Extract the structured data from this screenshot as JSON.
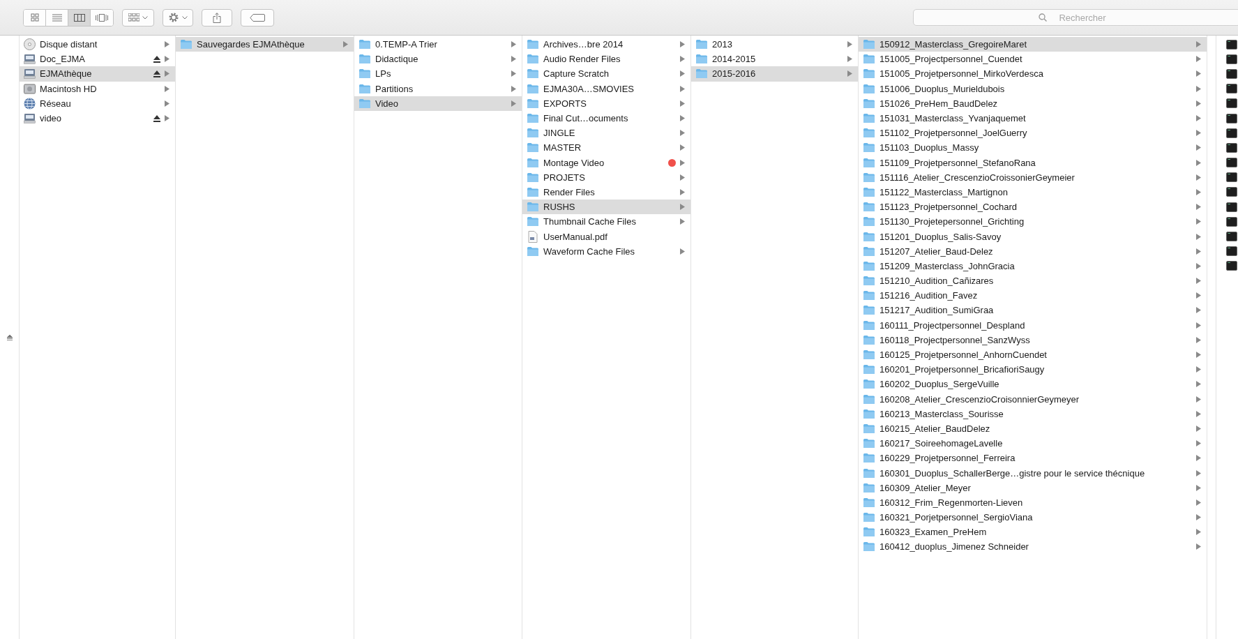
{
  "toolbar": {
    "views": [
      {
        "kind": "icons",
        "selected": false
      },
      {
        "kind": "list",
        "selected": false
      },
      {
        "kind": "columns",
        "selected": true
      },
      {
        "kind": "coverflow",
        "selected": false
      }
    ],
    "tools": [
      {
        "kind": "arrange"
      },
      {
        "kind": "action"
      },
      {
        "kind": "share"
      },
      {
        "kind": "tag"
      }
    ]
  },
  "search": {
    "placeholder": "Rechercher"
  },
  "columns": [
    {
      "items": [
        {
          "name": "Disque distant",
          "kind": "cd",
          "selected": false,
          "eject": false,
          "expandable": true
        },
        {
          "name": "Doc_EJMA",
          "kind": "drive",
          "selected": false,
          "eject": true,
          "expandable": true
        },
        {
          "name": "EJMAthèque",
          "kind": "drive",
          "selected": true,
          "eject": true,
          "expandable": true
        },
        {
          "name": "Macintosh HD",
          "kind": "hd",
          "selected": false,
          "eject": false,
          "expandable": true
        },
        {
          "name": "Réseau",
          "kind": "network",
          "selected": false,
          "eject": false,
          "expandable": true
        },
        {
          "name": "video",
          "kind": "drive",
          "selected": false,
          "eject": true,
          "expandable": true
        }
      ]
    },
    {
      "items": [
        {
          "name": "Sauvegardes EJMAthèque",
          "kind": "folder",
          "selected": true,
          "expandable": true
        }
      ]
    },
    {
      "items": [
        {
          "name": "0.TEMP-A Trier",
          "kind": "folder",
          "selected": false,
          "expandable": true
        },
        {
          "name": "Didactique",
          "kind": "folder",
          "selected": false,
          "expandable": true
        },
        {
          "name": "LPs",
          "kind": "folder",
          "selected": false,
          "expandable": true
        },
        {
          "name": "Partitions",
          "kind": "folder",
          "selected": false,
          "expandable": true
        },
        {
          "name": "Video",
          "kind": "folder",
          "selected": true,
          "expandable": true
        }
      ]
    },
    {
      "items": [
        {
          "name": "Archives…bre 2014",
          "kind": "folder",
          "selected": false,
          "expandable": true
        },
        {
          "name": "Audio Render Files",
          "kind": "folder",
          "selected": false,
          "expandable": true
        },
        {
          "name": "Capture Scratch",
          "kind": "folder",
          "selected": false,
          "expandable": true
        },
        {
          "name": "EJMA30A…SMOVIES",
          "kind": "folder",
          "selected": false,
          "expandable": true
        },
        {
          "name": "EXPORTS",
          "kind": "folder",
          "selected": false,
          "expandable": true
        },
        {
          "name": "Final Cut…ocuments",
          "kind": "folder",
          "selected": false,
          "expandable": true
        },
        {
          "name": "JINGLE",
          "kind": "folder",
          "selected": false,
          "expandable": true
        },
        {
          "name": "MASTER",
          "kind": "folder",
          "selected": false,
          "expandable": true
        },
        {
          "name": "Montage Video",
          "kind": "folder",
          "selected": false,
          "expandable": true,
          "color": "#f0504a"
        },
        {
          "name": "PROJETS",
          "kind": "folder",
          "selected": false,
          "expandable": true
        },
        {
          "name": "Render Files",
          "kind": "folder",
          "selected": false,
          "expandable": true
        },
        {
          "name": "RUSHS",
          "kind": "folder",
          "selected": true,
          "expandable": true
        },
        {
          "name": "Thumbnail Cache Files",
          "kind": "folder",
          "selected": false,
          "expandable": true
        },
        {
          "name": "UserManual.pdf",
          "kind": "file",
          "selected": false,
          "expandable": false
        },
        {
          "name": "Waveform Cache Files",
          "kind": "folder",
          "selected": false,
          "expandable": true
        }
      ]
    },
    {
      "items": [
        {
          "name": "2013",
          "kind": "folder",
          "selected": false,
          "expandable": true
        },
        {
          "name": "2014-2015",
          "kind": "folder",
          "selected": false,
          "expandable": true
        },
        {
          "name": "2015-2016",
          "kind": "folder",
          "selected": true,
          "expandable": true
        }
      ]
    },
    {
      "items": [
        {
          "name": "150912_Masterclass_GregoireMaret",
          "kind": "folder",
          "selected": true,
          "expandable": true
        },
        {
          "name": "151005_Projectpersonnel_Cuendet",
          "kind": "folder",
          "selected": false,
          "expandable": true
        },
        {
          "name": "151005_Projetpersonnel_MirkoVerdesca",
          "kind": "folder",
          "selected": false,
          "expandable": true
        },
        {
          "name": "151006_Duoplus_Murieldubois",
          "kind": "folder",
          "selected": false,
          "expandable": true
        },
        {
          "name": "151026_PreHem_BaudDelez",
          "kind": "folder",
          "selected": false,
          "expandable": true
        },
        {
          "name": "151031_Masterclass_Yvanjaquemet",
          "kind": "folder",
          "selected": false,
          "expandable": true
        },
        {
          "name": "151102_Projetpersonnel_JoelGuerry",
          "kind": "folder",
          "selected": false,
          "expandable": true
        },
        {
          "name": "151103_Duoplus_Massy",
          "kind": "folder",
          "selected": false,
          "expandable": true
        },
        {
          "name": "151109_Projetpersonnel_StefanoRana",
          "kind": "folder",
          "selected": false,
          "expandable": true
        },
        {
          "name": "151116_Atelier_CrescenzioCroissonierGeymeier",
          "kind": "folder",
          "selected": false,
          "expandable": true
        },
        {
          "name": "151122_Masterclass_Martignon",
          "kind": "folder",
          "selected": false,
          "expandable": true
        },
        {
          "name": "151123_Projetpersonnel_Cochard",
          "kind": "folder",
          "selected": false,
          "expandable": true
        },
        {
          "name": "151130_Projetepersonnel_Grichting",
          "kind": "folder",
          "selected": false,
          "expandable": true
        },
        {
          "name": "151201_Duoplus_Salis-Savoy",
          "kind": "folder",
          "selected": false,
          "expandable": true
        },
        {
          "name": "151207_Atelier_Baud-Delez",
          "kind": "folder",
          "selected": false,
          "expandable": true
        },
        {
          "name": "151209_Masterclass_JohnGracia",
          "kind": "folder",
          "selected": false,
          "expandable": true
        },
        {
          "name": "151210_Audition_Cañizares",
          "kind": "folder",
          "selected": false,
          "expandable": true
        },
        {
          "name": "151216_Audition_Favez",
          "kind": "folder",
          "selected": false,
          "expandable": true
        },
        {
          "name": "151217_Audition_SumiGraa",
          "kind": "folder",
          "selected": false,
          "expandable": true
        },
        {
          "name": "160111_Projectpersonnel_Despland",
          "kind": "folder",
          "selected": false,
          "expandable": true
        },
        {
          "name": "160118_Projectpersonnel_SanzWyss",
          "kind": "folder",
          "selected": false,
          "expandable": true
        },
        {
          "name": "160125_Projetpersonnel_AnhornCuendet",
          "kind": "folder",
          "selected": false,
          "expandable": true
        },
        {
          "name": "160201_Projetpersonnel_BricafioriSaugy",
          "kind": "folder",
          "selected": false,
          "expandable": true
        },
        {
          "name": "160202_Duoplus_SergeVuille",
          "kind": "folder",
          "selected": false,
          "expandable": true
        },
        {
          "name": "160208_Atelier_CrescenzioCroisonnierGeymeyer",
          "kind": "folder",
          "selected": false,
          "expandable": true
        },
        {
          "name": "160213_Masterclass_Sourisse",
          "kind": "folder",
          "selected": false,
          "expandable": true
        },
        {
          "name": "160215_Atelier_BaudDelez",
          "kind": "folder",
          "selected": false,
          "expandable": true
        },
        {
          "name": "160217_SoireehomageLavelle",
          "kind": "folder",
          "selected": false,
          "expandable": true
        },
        {
          "name": "160229_Projetpersonnel_Ferreira",
          "kind": "folder",
          "selected": false,
          "expandable": true
        },
        {
          "name": "160301_Duoplus_SchallerBerge…gistre pour le service thécnique",
          "kind": "folder",
          "selected": false,
          "expandable": true
        },
        {
          "name": "160309_Atelier_Meyer",
          "kind": "folder",
          "selected": false,
          "expandable": true
        },
        {
          "name": "160312_Frim_Regenmorten-Lieven",
          "kind": "folder",
          "selected": false,
          "expandable": true
        },
        {
          "name": "160321_Porjetpersonnel_SergioViana",
          "kind": "folder",
          "selected": false,
          "expandable": true
        },
        {
          "name": "160323_Examen_PreHem",
          "kind": "folder",
          "selected": false,
          "expandable": true
        },
        {
          "name": "160412_duoplus_Jimenez Schneider",
          "kind": "folder",
          "selected": false,
          "expandable": true
        }
      ]
    }
  ],
  "preview_column": {
    "items": [
      {
        "kind": "terminal"
      },
      {
        "kind": "terminal"
      },
      {
        "kind": "terminal"
      },
      {
        "kind": "terminal"
      },
      {
        "kind": "terminal"
      },
      {
        "kind": "terminal"
      },
      {
        "kind": "terminal"
      },
      {
        "kind": "terminal"
      },
      {
        "kind": "terminal"
      },
      {
        "kind": "terminal"
      },
      {
        "kind": "terminal"
      },
      {
        "kind": "terminal"
      },
      {
        "kind": "terminal"
      },
      {
        "kind": "terminal"
      },
      {
        "kind": "terminal"
      },
      {
        "kind": "terminal"
      }
    ]
  }
}
